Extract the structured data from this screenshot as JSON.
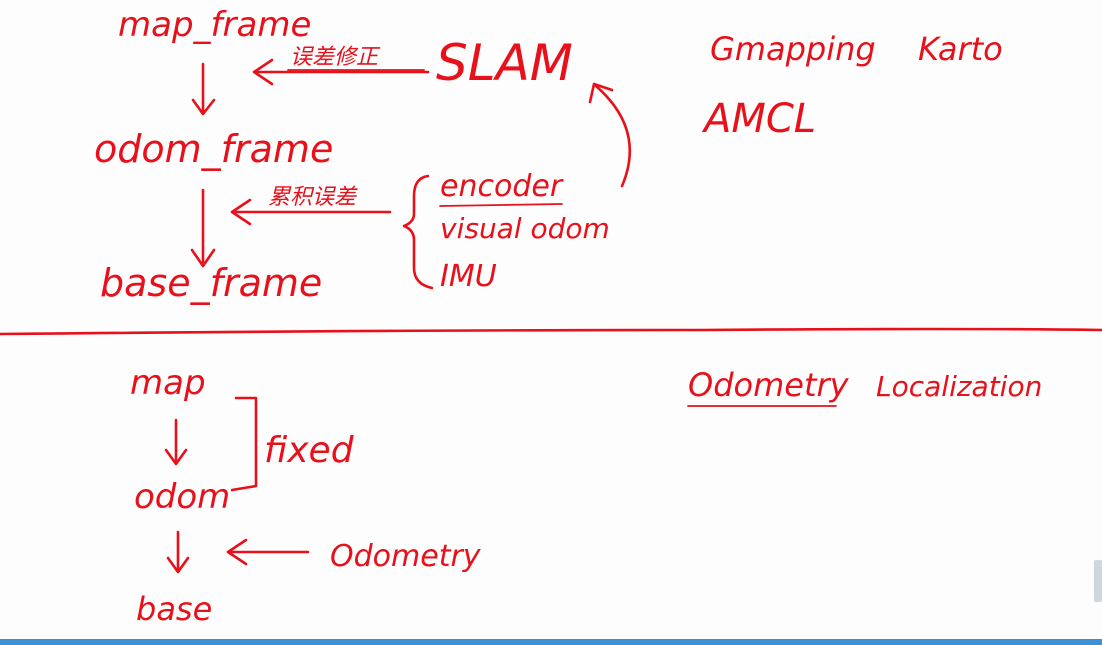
{
  "colors": {
    "ink": "#e8101a",
    "board": "#fdfdfd",
    "bottom_bar": "#3d8fd6",
    "scroll_handle": "#cfd6dc"
  },
  "top_diagram": {
    "frames": [
      "map_frame",
      "odom_frame",
      "base_frame"
    ],
    "correction_label": "误差修正",
    "slam_label": "SLAM",
    "accumulated_error_label": "累积误差",
    "sources": [
      "encoder",
      "visual odom",
      "IMU"
    ]
  },
  "algorithms": {
    "line1_a": "Gmapping",
    "line1_b": "Karto",
    "line2": "AMCL"
  },
  "bottom_diagram": {
    "frames": [
      "map",
      "odom",
      "base"
    ],
    "fixed_label": "fixed",
    "odometry_label": "Odometry"
  },
  "concepts": {
    "odometry": "Odometry",
    "localization": "Localization"
  }
}
